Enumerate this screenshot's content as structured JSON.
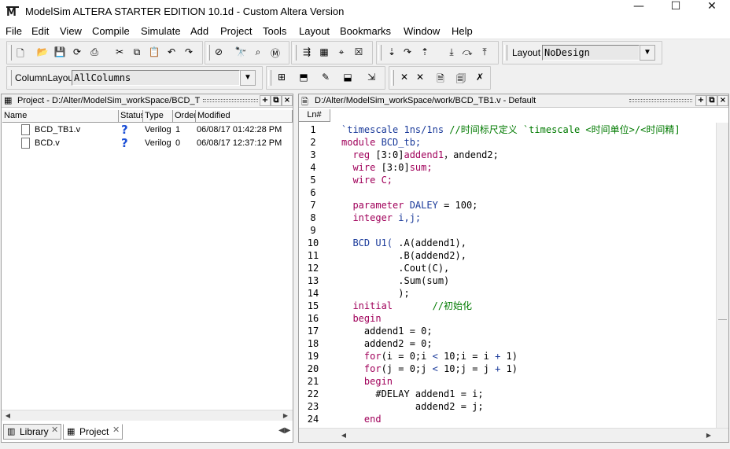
{
  "window": {
    "title": "ModelSim ALTERA STARTER EDITION 10.1d - Custom Altera Version",
    "app_icon_text": "M",
    "minimize_glyph": "—",
    "maximize_glyph": "☐",
    "close_glyph": "✕"
  },
  "menu": [
    "File",
    "Edit",
    "View",
    "Compile",
    "Simulate",
    "Add",
    "Project",
    "Tools",
    "Layout",
    "Bookmarks",
    "Window",
    "Help"
  ],
  "toolbar": {
    "layout_label": "Layout",
    "layout_value": "NoDesign",
    "column_layout_label": "ColumnLayout",
    "column_layout_value": "AllColumns",
    "combo_arrow": "▼"
  },
  "project_panel": {
    "title": "Project - D:/Alter/ModelSim_workSpace/BCD_TB",
    "columns": [
      "Name",
      "Status",
      "Type",
      "Order",
      "Modified"
    ],
    "files": [
      {
        "name": "BCD_TB1.v",
        "status": "?",
        "type": "Verilog",
        "order": "1",
        "modified": "06/08/17 01:42:28 PM"
      },
      {
        "name": "BCD.v",
        "status": "?",
        "type": "Verilog",
        "order": "0",
        "modified": "06/08/17 12:37:12 PM"
      }
    ],
    "tabs": [
      {
        "label": "Library",
        "active": false
      },
      {
        "label": "Project",
        "active": true
      }
    ],
    "tab_close": "✕"
  },
  "editor_panel": {
    "title": "D:/Alter/ModelSim_workSpace/work/BCD_TB1.v - Default",
    "ln_header": "Ln#",
    "lines": [
      {
        "n": "1",
        "parts": [
          {
            "t": "`timescale 1ns/1ns ",
            "c": "id"
          },
          {
            "t": "//时间标尺定义 `timescale <时间单位>/<时间精]",
            "c": "cmt"
          }
        ]
      },
      {
        "n": "2",
        "parts": [
          {
            "t": "module ",
            "c": "kw"
          },
          {
            "t": "BCD_tb;",
            "c": "id"
          }
        ]
      },
      {
        "n": "3",
        "parts": [
          {
            "t": "  reg ",
            "c": "kw"
          },
          {
            "t": "[3:0]",
            "c": ""
          },
          {
            "t": "addend1",
            "c": "kw"
          },
          {
            "t": "，andend2;",
            "c": ""
          }
        ]
      },
      {
        "n": "4",
        "parts": [
          {
            "t": "  wire ",
            "c": "kw"
          },
          {
            "t": "[3:0]",
            "c": ""
          },
          {
            "t": "sum;",
            "c": "kw"
          }
        ]
      },
      {
        "n": "5",
        "parts": [
          {
            "t": "  wire ",
            "c": "kw"
          },
          {
            "t": "C;",
            "c": "kw"
          }
        ]
      },
      {
        "n": "6",
        "parts": [
          {
            "t": "",
            "c": ""
          }
        ]
      },
      {
        "n": "7",
        "parts": [
          {
            "t": "  parameter ",
            "c": "kw"
          },
          {
            "t": "DALEY ",
            "c": "id"
          },
          {
            "t": "= 100;",
            "c": ""
          }
        ]
      },
      {
        "n": "8",
        "parts": [
          {
            "t": "  integer ",
            "c": "kw"
          },
          {
            "t": "i,j;",
            "c": "id"
          }
        ]
      },
      {
        "n": "9",
        "parts": [
          {
            "t": "",
            "c": ""
          }
        ]
      },
      {
        "n": "10",
        "parts": [
          {
            "t": "  BCD U1( ",
            "c": "id"
          },
          {
            "t": ".A(addend1),",
            "c": ""
          }
        ]
      },
      {
        "n": "11",
        "parts": [
          {
            "t": "          .B(addend2),",
            "c": ""
          }
        ]
      },
      {
        "n": "12",
        "parts": [
          {
            "t": "          .Cout(C),",
            "c": ""
          }
        ]
      },
      {
        "n": "13",
        "parts": [
          {
            "t": "          .Sum(sum)",
            "c": ""
          }
        ]
      },
      {
        "n": "14",
        "parts": [
          {
            "t": "          );",
            "c": ""
          }
        ]
      },
      {
        "n": "15",
        "parts": [
          {
            "t": "  initial       ",
            "c": "kw"
          },
          {
            "t": "//初始化",
            "c": "cmt"
          }
        ]
      },
      {
        "n": "16",
        "parts": [
          {
            "t": "  begin",
            "c": "kw"
          }
        ]
      },
      {
        "n": "17",
        "parts": [
          {
            "t": "    addend1 = 0;",
            "c": ""
          }
        ]
      },
      {
        "n": "18",
        "parts": [
          {
            "t": "    addend2 = 0;",
            "c": ""
          }
        ]
      },
      {
        "n": "19",
        "parts": [
          {
            "t": "    for",
            "c": "kw"
          },
          {
            "t": "(i = 0;i ",
            "c": ""
          },
          {
            "t": "<",
            "c": "id"
          },
          {
            "t": " 10;i = i ",
            "c": ""
          },
          {
            "t": "+",
            "c": "id"
          },
          {
            "t": " 1)",
            "c": ""
          }
        ]
      },
      {
        "n": "20",
        "parts": [
          {
            "t": "    for",
            "c": "kw"
          },
          {
            "t": "(j = 0;j ",
            "c": ""
          },
          {
            "t": "<",
            "c": "id"
          },
          {
            "t": " 10;j = j ",
            "c": ""
          },
          {
            "t": "+",
            "c": "id"
          },
          {
            "t": " 1)",
            "c": ""
          }
        ]
      },
      {
        "n": "21",
        "parts": [
          {
            "t": "    begin",
            "c": "kw"
          }
        ]
      },
      {
        "n": "22",
        "parts": [
          {
            "t": "      #DELAY addend1 = i;",
            "c": ""
          }
        ]
      },
      {
        "n": "23",
        "parts": [
          {
            "t": "             addend2 = j;",
            "c": ""
          }
        ]
      },
      {
        "n": "24",
        "parts": [
          {
            "t": "    end",
            "c": "kw"
          }
        ]
      }
    ]
  }
}
